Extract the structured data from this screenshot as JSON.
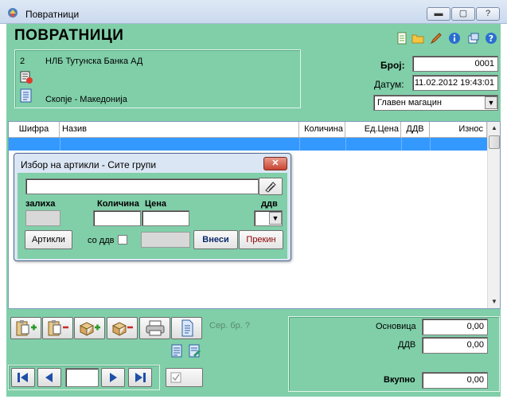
{
  "window": {
    "title": "Повратници",
    "minimize_label": "▬",
    "maximize_label": "▢",
    "close_label": "✕"
  },
  "header": {
    "heading": "ПОВРАТНИЦИ",
    "client_code": "2",
    "client_name": "НЛБ Тутунска Банка АД",
    "client_city": "Скопје - Македонија"
  },
  "doc": {
    "number_label": "Број:",
    "number_value": "0001",
    "date_label": "Датум:",
    "date_value": "11.02.2012 19:43:01",
    "warehouse_value": "Главен магацин"
  },
  "grid": {
    "columns": [
      "Шифра",
      "Назив",
      "Количина",
      "Ед.Цена",
      "ДДВ",
      "Износ"
    ]
  },
  "dialog": {
    "title": "Избор на артикли - Сите групи",
    "close_label": "✕",
    "search_value": "",
    "stock_label": "залиха",
    "qty_label": "Количина",
    "price_label": "Цена",
    "vat_label": "ддв",
    "articles_button": "Артикли",
    "with_vat_label": "со ддв",
    "enter_button": "Внеси",
    "cancel_button": "Прекин"
  },
  "footer": {
    "serial_label": "Сер. бр.  ?",
    "base_label": "Основица",
    "base_value": "0,00",
    "vat_label": "ДДВ",
    "vat_value": "0,00",
    "total_label": "Вкупно",
    "total_value": "0,00",
    "record_value": ""
  },
  "colors": {
    "form_background": "#80cfa9",
    "selection": "#3399ff",
    "dialog_frame": "#dbe6f4",
    "cancel_text": "#8b0000"
  }
}
